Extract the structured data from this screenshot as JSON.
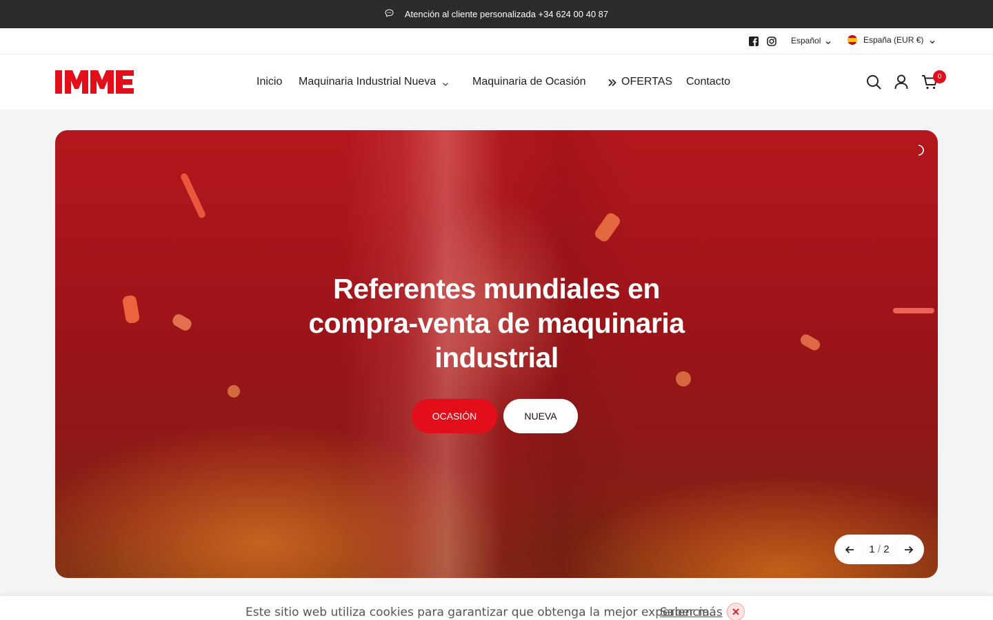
{
  "announcement": {
    "icon": "chat-bubble-icon",
    "text": "Atención al cliente personalizada +34 624 00 40 87"
  },
  "utility": {
    "social": [
      "facebook-icon",
      "instagram-icon"
    ],
    "language": "Español",
    "country": "España (EUR €)"
  },
  "header": {
    "logo_text": "IMME",
    "nav": [
      {
        "label": "Inicio"
      },
      {
        "label": "Maquinaria Industrial Nueva",
        "has_dropdown": true
      },
      {
        "label": "Maquinaria de Ocasión"
      },
      {
        "label": "OFERTAS",
        "icon": "double-chevron-right-icon"
      },
      {
        "label": "Contacto"
      }
    ],
    "cart_count": "0",
    "icons": [
      "search-icon",
      "account-icon",
      "cart-icon"
    ]
  },
  "hero": {
    "title": "Referentes mundiales en compra-venta de maquinaria industrial",
    "buttons": {
      "primary": "OCASIÓN",
      "secondary": "NUEVA"
    },
    "slide_current": "1",
    "slide_sep": "/",
    "slide_total": "2"
  },
  "cookie": {
    "message": "Este sitio web utiliza cookies para garantizar que obtenga la mejor experiencia.",
    "link": "Saber más"
  },
  "colors": {
    "brand_red": "#e20e1a",
    "dark_bar": "#2b2b2b"
  }
}
